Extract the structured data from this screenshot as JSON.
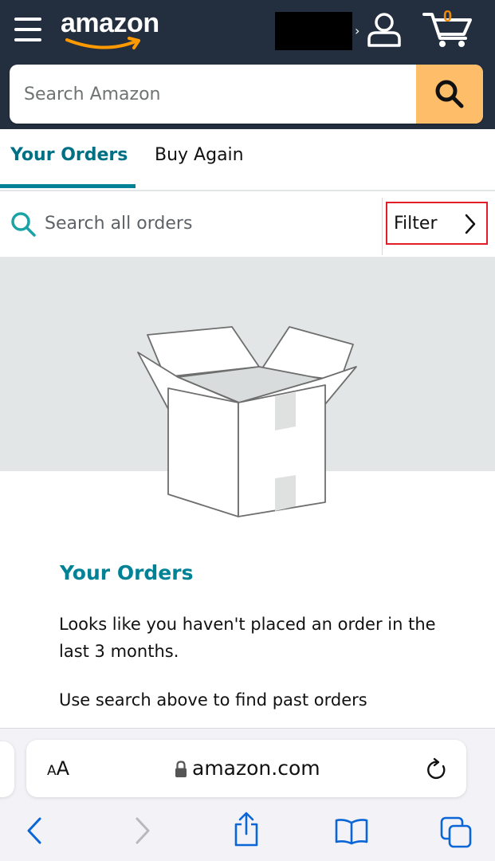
{
  "header": {
    "logo_text": "amazon",
    "cart_count": "0",
    "search_placeholder": "Search Amazon"
  },
  "tabs": [
    {
      "label": "Your Orders",
      "active": true
    },
    {
      "label": "Buy Again",
      "active": false
    }
  ],
  "order_search": {
    "placeholder": "Search all orders",
    "filter_label": "Filter"
  },
  "empty_state": {
    "title": "Your Orders",
    "message": "Looks like you haven't placed an order in the last 3 months.",
    "hint": "Use search above to find past orders"
  },
  "browser": {
    "text_size_label_small": "A",
    "text_size_label_big": "A",
    "url": "amazon.com"
  },
  "colors": {
    "header_bg": "#232f3e",
    "search_button": "#febd69",
    "accent_teal": "#008296",
    "cart_count": "#f08804",
    "filter_highlight": "#e11d2a"
  }
}
